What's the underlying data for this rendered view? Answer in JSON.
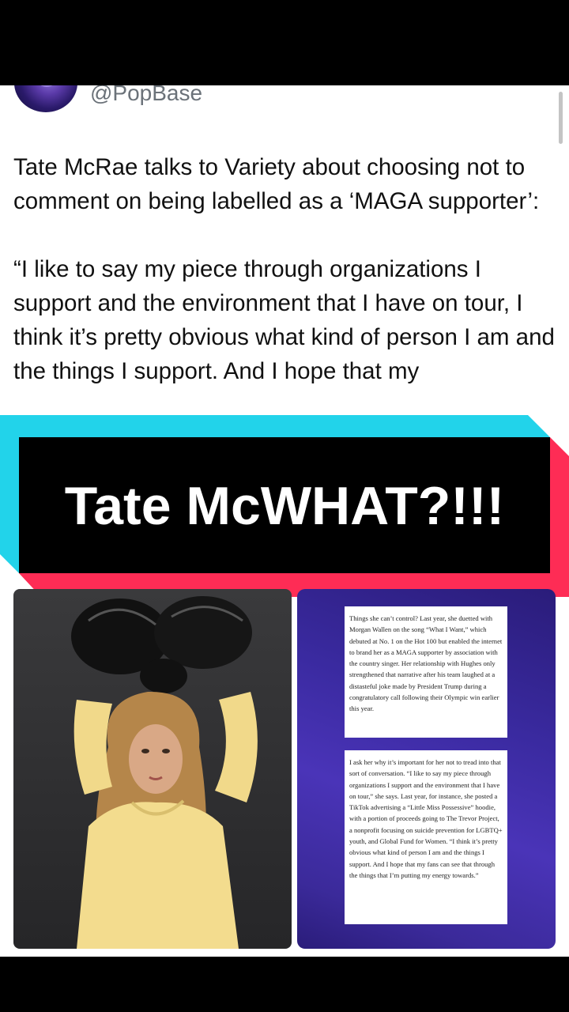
{
  "tweet": {
    "handle": "@PopBase",
    "paragraph1": "Tate McRae talks to Variety about choosing not to comment on being labelled as a ‘MAGA supporter’:",
    "paragraph2": "“I like to say my piece through organizations I support and the environment that I have on tour, I think it’s pretty obvious what kind of person I am and the things I support. And I hope that my"
  },
  "banner": {
    "text": "Tate McWHAT?!!!",
    "colors": {
      "cyan": "#22d3ea",
      "red": "#fe2c55",
      "black": "#000000"
    }
  },
  "article": {
    "box1": "Things she can’t control? Last year, she duetted with Morgan Wallen on the song “What I Want,” which debuted at No. 1 on the Hot 100 but enabled the internet to brand her as a MAGA supporter by association with the country singer. Her relationship with Hughes only strengthened that narrative after his team laughed at a distasteful joke made by President Trump during a congratulatory call following their Olympic win earlier this year.",
    "box2": "I ask her why it’s important for her not to tread into that sort of conversation. “I like to say my piece through organizations I support and the environment that I have on tour,” she says. Last year, for instance, she posted a TikTok advertising a “Little Miss Possessive” hoodie, with a portion of proceeds going to The Trevor Project, a nonprofit focusing on suicide prevention for LGBTQ+ youth, and Global Fund for Women. “I think it’s pretty obvious what kind of person I am and the things I support. And I hope that my fans can see that through the things that I’m putting my energy towards.”"
  }
}
